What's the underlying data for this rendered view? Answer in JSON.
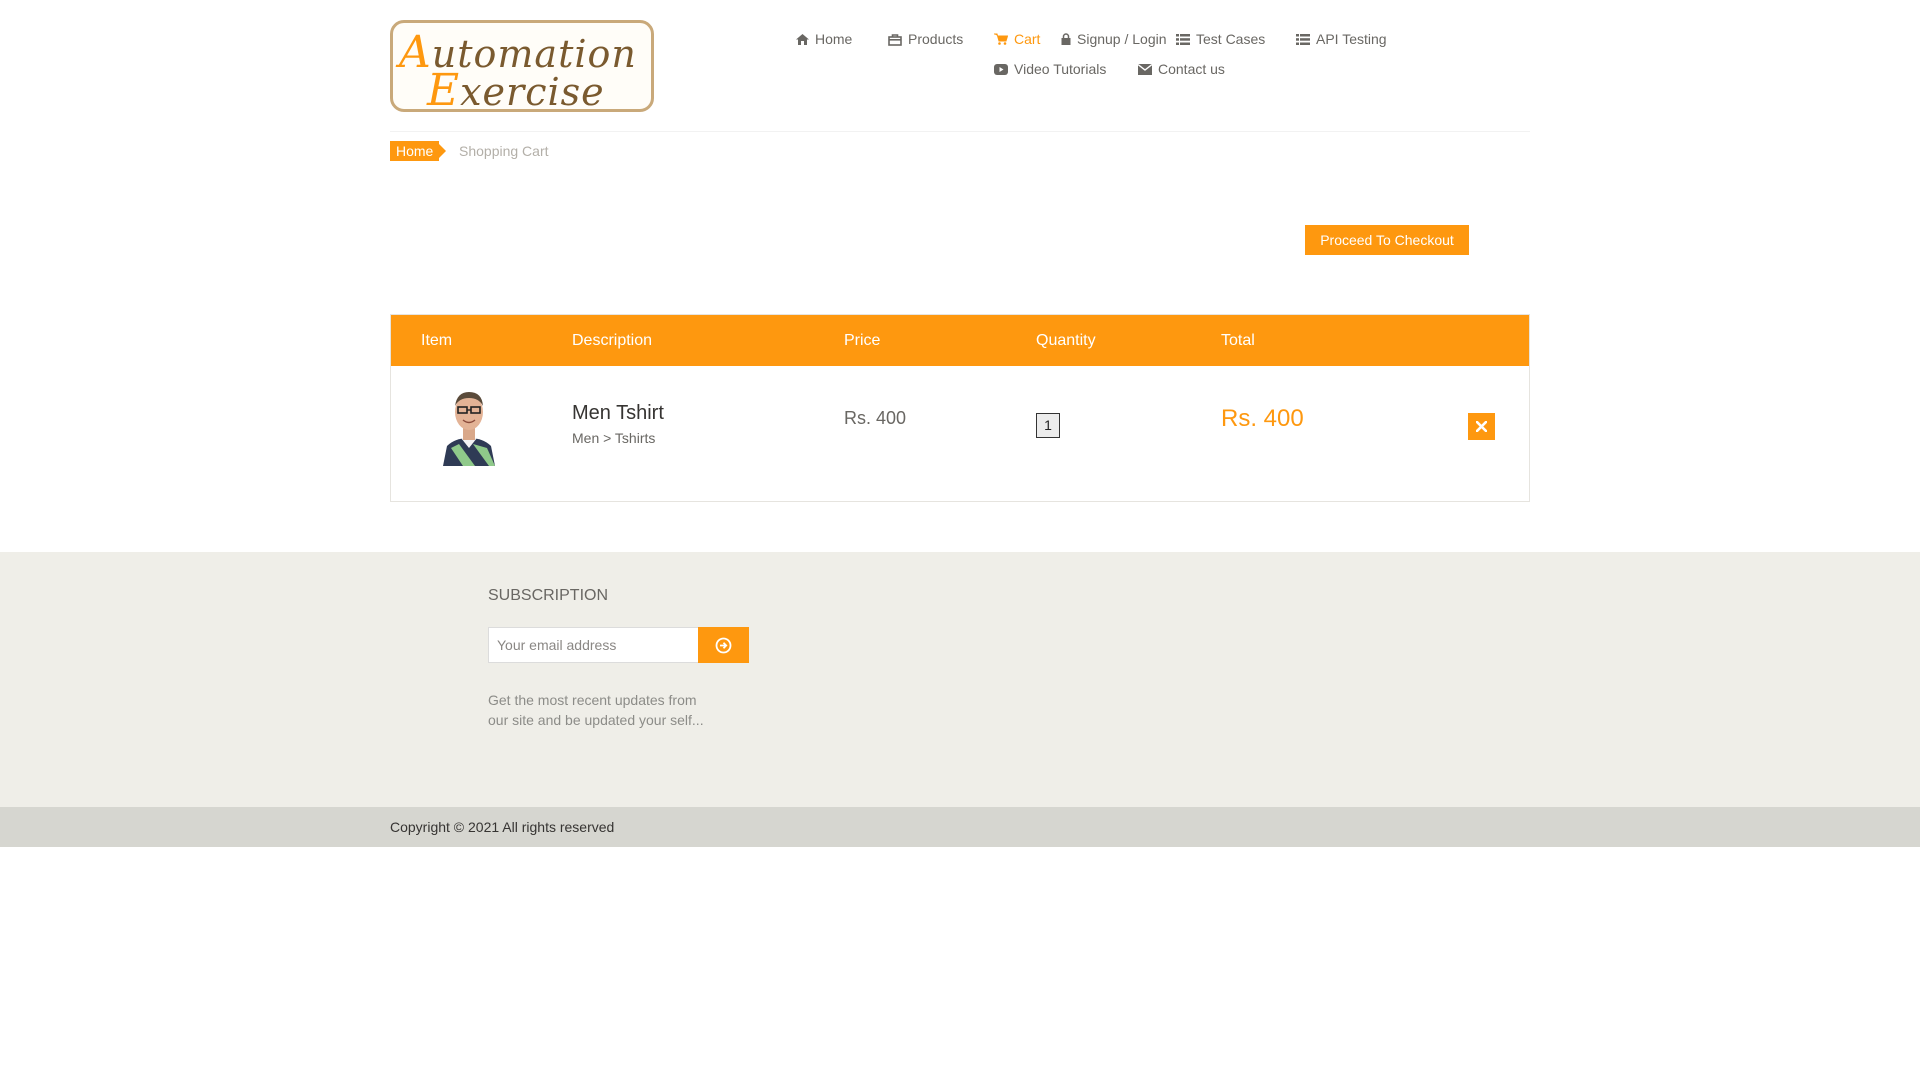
{
  "logo": {
    "line1_cap": "A",
    "line1_rest": "utomation",
    "line2_cap": "E",
    "line2_rest": "xercise"
  },
  "nav": {
    "items": [
      {
        "label": "Home",
        "icon": "home-icon"
      },
      {
        "label": "Products",
        "icon": "shopping-bag-icon"
      },
      {
        "label": "Cart",
        "icon": "cart-icon",
        "active": true
      },
      {
        "label": "Signup / Login",
        "icon": "lock-icon"
      },
      {
        "label": "Test Cases",
        "icon": "list-icon"
      },
      {
        "label": "API Testing",
        "icon": "list-icon"
      },
      {
        "label": "Video Tutorials",
        "icon": "youtube-play-icon"
      },
      {
        "label": "Contact us",
        "icon": "envelope-icon"
      }
    ]
  },
  "breadcrumb": {
    "home": "Home",
    "current": "Shopping Cart"
  },
  "checkout": {
    "label": "Proceed To Checkout"
  },
  "cart": {
    "headers": [
      "Item",
      "Description",
      "Price",
      "Quantity",
      "Total"
    ],
    "items": [
      {
        "name": "Men Tshirt",
        "category": "Men > Tshirts",
        "price": "Rs. 400",
        "quantity": "1",
        "total": "Rs. 400"
      }
    ]
  },
  "subscription": {
    "title": "SUBSCRIPTION",
    "placeholder": "Your email address",
    "text": "Get the most recent updates from our site and be updated your self..."
  },
  "footer": {
    "copyright": "Copyright © 2021 All rights reserved"
  },
  "colors": {
    "accent": "#FE980F",
    "footer_bg": "#EFEEE8",
    "footer_bottom_bg": "#D6D6D0"
  }
}
